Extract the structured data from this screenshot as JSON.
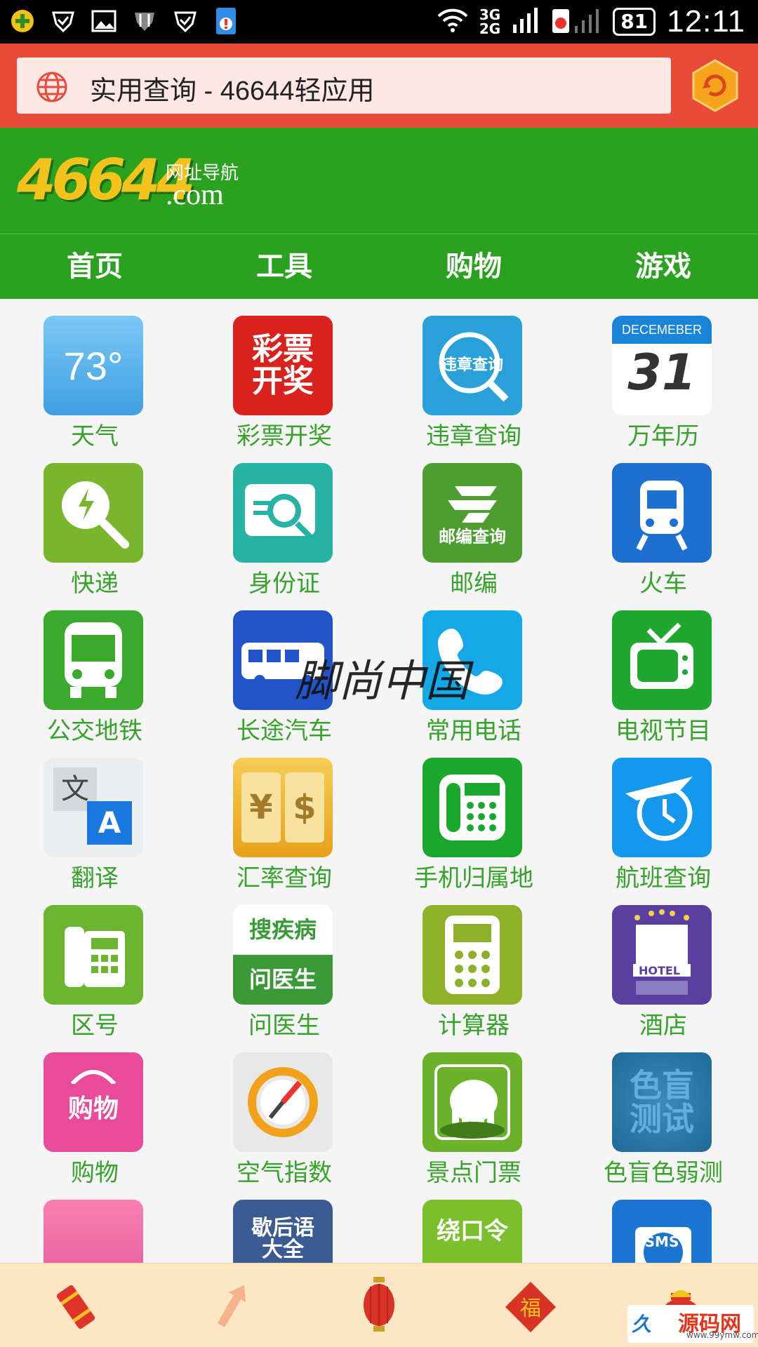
{
  "status_bar": {
    "network_top": "3G",
    "network_bottom": "2G",
    "battery": "81",
    "time": "12:11"
  },
  "address_bar": {
    "title": "实用查询 - 46644轻应用"
  },
  "logo": {
    "number": "46644",
    "subtitle": "网址导航",
    "domain": ".com"
  },
  "tabs": [
    {
      "label": "首页"
    },
    {
      "label": "工具"
    },
    {
      "label": "购物"
    },
    {
      "label": "游戏"
    }
  ],
  "grid": [
    {
      "label": "天气",
      "icon": "weather-icon",
      "icon_text": "73°",
      "bg": "#5fb8f0"
    },
    {
      "label": "彩票开奖",
      "icon": "lottery-icon",
      "icon_text": "彩票\n开奖",
      "bg": "#d9221d"
    },
    {
      "label": "违章查询",
      "icon": "traffic-violation-icon",
      "icon_text": "违章查询",
      "bg": "#2aa0d8"
    },
    {
      "label": "万年历",
      "icon": "calendar-icon",
      "icon_text": "31",
      "icon_subtext": "DECEMEBER",
      "bg": "#ffffff"
    },
    {
      "label": "快递",
      "icon": "express-search-icon",
      "icon_text": "",
      "bg": "#7ab62d"
    },
    {
      "label": "身份证",
      "icon": "id-card-icon",
      "icon_text": "",
      "bg": "#27b3a3"
    },
    {
      "label": "邮编",
      "icon": "postcode-icon",
      "icon_text": "邮编查询",
      "bg": "#4d9e2f"
    },
    {
      "label": "火车",
      "icon": "train-icon",
      "icon_text": "",
      "bg": "#1f6fd1"
    },
    {
      "label": "公交地铁",
      "icon": "bus-icon",
      "icon_text": "",
      "bg": "#3aa92c"
    },
    {
      "label": "长途汽车",
      "icon": "coach-icon",
      "icon_text": "",
      "bg": "#2254c7"
    },
    {
      "label": "常用电话",
      "icon": "phone-icon",
      "icon_text": "",
      "bg": "#14a8e8"
    },
    {
      "label": "电视节目",
      "icon": "tv-icon",
      "icon_text": "",
      "bg": "#1fa72f"
    },
    {
      "label": "翻译",
      "icon": "translate-icon",
      "icon_text": "文 A",
      "bg": "#e9ecef"
    },
    {
      "label": "汇率查询",
      "icon": "exchange-rate-icon",
      "icon_text": "¥ $",
      "bg": "#f0b427"
    },
    {
      "label": "手机归属地",
      "icon": "mobile-location-icon",
      "icon_text": "",
      "bg": "#1aa72b"
    },
    {
      "label": "航班查询",
      "icon": "flight-icon",
      "icon_text": "",
      "bg": "#1498ee"
    },
    {
      "label": "区号",
      "icon": "area-code-icon",
      "icon_text": "",
      "bg": "#6cb530"
    },
    {
      "label": "问医生",
      "icon": "doctor-icon",
      "icon_text": "搜疾病\n问医生",
      "bg": "#3a9a37"
    },
    {
      "label": "计算器",
      "icon": "calculator-icon",
      "icon_text": "",
      "bg": "#8db128"
    },
    {
      "label": "酒店",
      "icon": "hotel-icon",
      "icon_text": "HOTEL",
      "bg": "#5a3fa0"
    },
    {
      "label": "购物",
      "icon": "shopping-bag-icon",
      "icon_text": "购物",
      "bg": "#e94a9a"
    },
    {
      "label": "空气指数",
      "icon": "air-index-icon",
      "icon_text": "",
      "bg": "#e8e8e8"
    },
    {
      "label": "景点门票",
      "icon": "scenic-ticket-icon",
      "icon_text": "",
      "bg": "#6bb22a"
    },
    {
      "label": "色盲色弱测",
      "icon": "color-blind-icon",
      "icon_text": "色盲\n测试",
      "bg": "#2f7fae"
    },
    {
      "label": "",
      "icon": "brain-teaser-icon",
      "icon_text": "",
      "bg": "#f2669c"
    },
    {
      "label": "",
      "icon": "xiehouyu-icon",
      "icon_text": "歇后语\n大全",
      "bg": "#3b5c93"
    },
    {
      "label": "",
      "icon": "tongue-twister-icon",
      "icon_text": "绕口令",
      "bg": "#7cbf2c"
    },
    {
      "label": "",
      "icon": "sms-icon",
      "icon_text": "SMS",
      "bg": "#1a74d1"
    }
  ],
  "watermark": "脚尚中国",
  "bottom_bar": {
    "items": [
      {
        "name": "firecracker-icon"
      },
      {
        "name": "firework-icon"
      },
      {
        "name": "lantern-icon"
      },
      {
        "name": "fortune-icon",
        "text": "福"
      },
      {
        "name": "lucky-bag-icon"
      }
    ],
    "badge_text": "源码网",
    "badge_url": "www.99ymw.com"
  }
}
